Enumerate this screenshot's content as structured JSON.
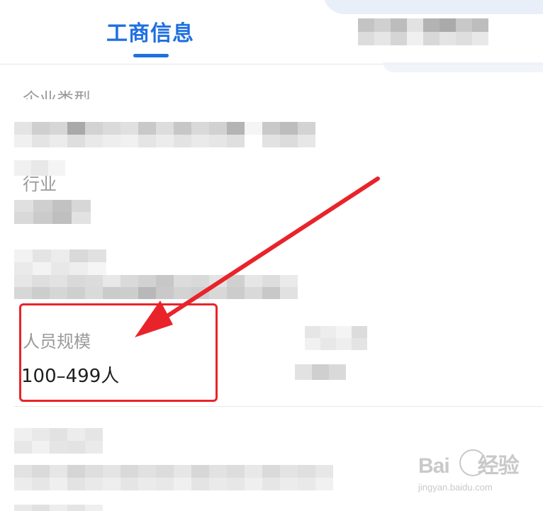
{
  "tabs": [
    {
      "label": "工商信息",
      "active": true
    },
    {
      "label": "",
      "active": false,
      "blurred": true
    }
  ],
  "fields": [
    {
      "label": "企业类型",
      "value": "",
      "label_partially_blurred": true,
      "value_blurred": true
    },
    {
      "label": "行业",
      "value": "",
      "label_partially_blurred": true,
      "value_blurred": true
    },
    {
      "label": "",
      "value": "",
      "label_blurred": true,
      "value_blurred": true
    },
    {
      "label": "人员规模",
      "value": "100–499人",
      "highlighted": true
    },
    {
      "label": "",
      "value": "",
      "label_partially_blurred": true,
      "value_blurred": true
    },
    {
      "label": "",
      "value": "",
      "label_blurred": true,
      "value_blurred": true
    }
  ],
  "annotation": {
    "color": "#e8242a"
  },
  "watermark": {
    "main": "Bai",
    "main2": "经验",
    "sub": "jingyan.baidu.com"
  },
  "colors": {
    "accent": "#1f6fe0",
    "highlight": "#e8242a",
    "label": "#9a9a9a"
  }
}
